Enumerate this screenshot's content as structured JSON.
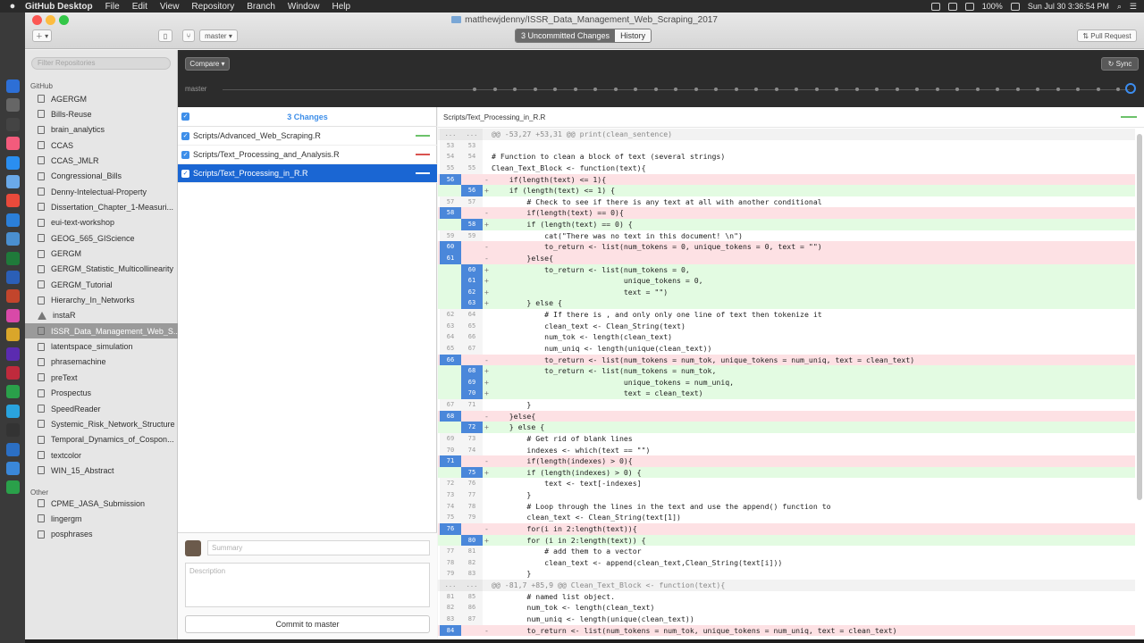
{
  "menubar": {
    "app": "GitHub Desktop",
    "items": [
      "File",
      "Edit",
      "View",
      "Repository",
      "Branch",
      "Window",
      "Help"
    ],
    "battery": "100%",
    "datetime": "Sun Jul 30  3:36:54 PM"
  },
  "window": {
    "title": "matthewjdenny/ISSR_Data_Management_Web_Scraping_2017",
    "branch": "master",
    "tabs": {
      "uncommitted": "3 Uncommitted Changes",
      "history": "History"
    },
    "pull_request": "Pull Request"
  },
  "sidebar": {
    "filter_placeholder": "Filter Repositories",
    "github_label": "GitHub",
    "other_label": "Other",
    "github_repos": [
      "AGERGM",
      "Bills-Reuse",
      "brain_analytics",
      "CCAS",
      "CCAS_JMLR",
      "Congressional_Bills",
      "Denny-Intelectual-Property",
      "Dissertation_Chapter_1-Measuri...",
      "eui-text-workshop",
      "GEOG_565_GIScience",
      "GERGM",
      "GERGM_Statistic_Multicollinearity",
      "GERGM_Tutorial",
      "Hierarchy_In_Networks",
      "instaR",
      "ISSR_Data_Management_Web_S...",
      "latentspace_simulation",
      "phrasemachine",
      "preText",
      "Prospectus",
      "SpeedReader",
      "Systemic_Risk_Network_Structure",
      "Temporal_Dynamics_of_Cospon...",
      "textcolor",
      "WIN_15_Abstract"
    ],
    "selected_index": 15,
    "other_repos": [
      "CPME_JASA_Submission",
      "lingergm",
      "posphrases"
    ]
  },
  "toolbar": {
    "compare": "Compare",
    "sync": "Sync",
    "branch_label": "master"
  },
  "changes": {
    "count_label": "3 Changes",
    "files": [
      "Scripts/Advanced_Web_Scraping.R",
      "Scripts/Text_Processing_and_Analysis.R",
      "Scripts/Text_Processing_in_R.R"
    ],
    "summary_placeholder": "Summary",
    "description_placeholder": "Description",
    "commit_button": "Commit to master"
  },
  "diff": {
    "path": "Scripts/Text_Processing_in_R.R",
    "lines": [
      {
        "k": "hunk",
        "o": "...",
        "n": "...",
        "t": "@@ -53,27 +53,31 @@ print(clean_sentence)"
      },
      {
        "k": "ctx",
        "o": "53",
        "n": "53",
        "t": ""
      },
      {
        "k": "ctx",
        "o": "54",
        "n": "54",
        "t": "# Function to clean a block of text (several strings)"
      },
      {
        "k": "ctx",
        "o": "55",
        "n": "55",
        "t": "Clean_Text_Block <- function(text){"
      },
      {
        "k": "del",
        "o": "56",
        "n": "",
        "t": "    if(length(text) <= 1){"
      },
      {
        "k": "add",
        "o": "",
        "n": "56",
        "t": "    if (length(text) <= 1) {"
      },
      {
        "k": "ctx",
        "o": "57",
        "n": "57",
        "t": "        # Check to see if there is any text at all with another conditional"
      },
      {
        "k": "del",
        "o": "58",
        "n": "",
        "t": "        if(length(text) == 0){"
      },
      {
        "k": "add",
        "o": "",
        "n": "58",
        "t": "        if (length(text) == 0) {"
      },
      {
        "k": "ctx",
        "o": "59",
        "n": "59",
        "t": "            cat(\"There was no text in this document! \\n\")"
      },
      {
        "k": "del",
        "o": "60",
        "n": "",
        "t": "            to_return <- list(num_tokens = 0, unique_tokens = 0, text = \"\")"
      },
      {
        "k": "del",
        "o": "61",
        "n": "",
        "t": "        }else{"
      },
      {
        "k": "add",
        "o": "",
        "n": "60",
        "t": "            to_return <- list(num_tokens = 0,"
      },
      {
        "k": "add",
        "o": "",
        "n": "61",
        "t": "                              unique_tokens = 0,"
      },
      {
        "k": "add",
        "o": "",
        "n": "62",
        "t": "                              text = \"\")"
      },
      {
        "k": "add",
        "o": "",
        "n": "63",
        "t": "        } else {"
      },
      {
        "k": "ctx",
        "o": "62",
        "n": "64",
        "t": "            # If there is , and only only one line of text then tokenize it"
      },
      {
        "k": "ctx",
        "o": "63",
        "n": "65",
        "t": "            clean_text <- Clean_String(text)"
      },
      {
        "k": "ctx",
        "o": "64",
        "n": "66",
        "t": "            num_tok <- length(clean_text)"
      },
      {
        "k": "ctx",
        "o": "65",
        "n": "67",
        "t": "            num_uniq <- length(unique(clean_text))"
      },
      {
        "k": "del",
        "o": "66",
        "n": "",
        "t": "            to_return <- list(num_tokens = num_tok, unique_tokens = num_uniq, text = clean_text)"
      },
      {
        "k": "add",
        "o": "",
        "n": "68",
        "t": "            to_return <- list(num_tokens = num_tok,"
      },
      {
        "k": "add",
        "o": "",
        "n": "69",
        "t": "                              unique_tokens = num_uniq,"
      },
      {
        "k": "add",
        "o": "",
        "n": "70",
        "t": "                              text = clean_text)"
      },
      {
        "k": "ctx",
        "o": "67",
        "n": "71",
        "t": "        }"
      },
      {
        "k": "del",
        "o": "68",
        "n": "",
        "t": "    }else{"
      },
      {
        "k": "add",
        "o": "",
        "n": "72",
        "t": "    } else {"
      },
      {
        "k": "ctx",
        "o": "69",
        "n": "73",
        "t": "        # Get rid of blank lines"
      },
      {
        "k": "ctx",
        "o": "70",
        "n": "74",
        "t": "        indexes <- which(text == \"\")"
      },
      {
        "k": "del",
        "o": "71",
        "n": "",
        "t": "        if(length(indexes) > 0){"
      },
      {
        "k": "add",
        "o": "",
        "n": "75",
        "t": "        if (length(indexes) > 0) {"
      },
      {
        "k": "ctx",
        "o": "72",
        "n": "76",
        "t": "            text <- text[-indexes]"
      },
      {
        "k": "ctx",
        "o": "73",
        "n": "77",
        "t": "        }"
      },
      {
        "k": "ctx",
        "o": "74",
        "n": "78",
        "t": "        # Loop through the lines in the text and use the append() function to"
      },
      {
        "k": "ctx",
        "o": "75",
        "n": "79",
        "t": "        clean_text <- Clean_String(text[1])"
      },
      {
        "k": "del",
        "o": "76",
        "n": "",
        "t": "        for(i in 2:length(text)){"
      },
      {
        "k": "add",
        "o": "",
        "n": "80",
        "t": "        for (i in 2:length(text)) {"
      },
      {
        "k": "ctx",
        "o": "77",
        "n": "81",
        "t": "            # add them to a vector"
      },
      {
        "k": "ctx",
        "o": "78",
        "n": "82",
        "t": "            clean_text <- append(clean_text,Clean_String(text[i]))"
      },
      {
        "k": "ctx",
        "o": "79",
        "n": "83",
        "t": "        }"
      },
      {
        "k": "hunk",
        "o": "...",
        "n": "...",
        "t": "@@ -81,7 +85,9 @@ Clean_Text_Block <- function(text){"
      },
      {
        "k": "ctx",
        "o": "81",
        "n": "85",
        "t": "        # named list object."
      },
      {
        "k": "ctx",
        "o": "82",
        "n": "86",
        "t": "        num_tok <- length(clean_text)"
      },
      {
        "k": "ctx",
        "o": "83",
        "n": "87",
        "t": "        num_uniq <- length(unique(clean_text))"
      },
      {
        "k": "del",
        "o": "84",
        "n": "",
        "t": "        to_return <- list(num_tokens = num_tok, unique_tokens = num_uniq, text = clean_text)"
      }
    ]
  }
}
